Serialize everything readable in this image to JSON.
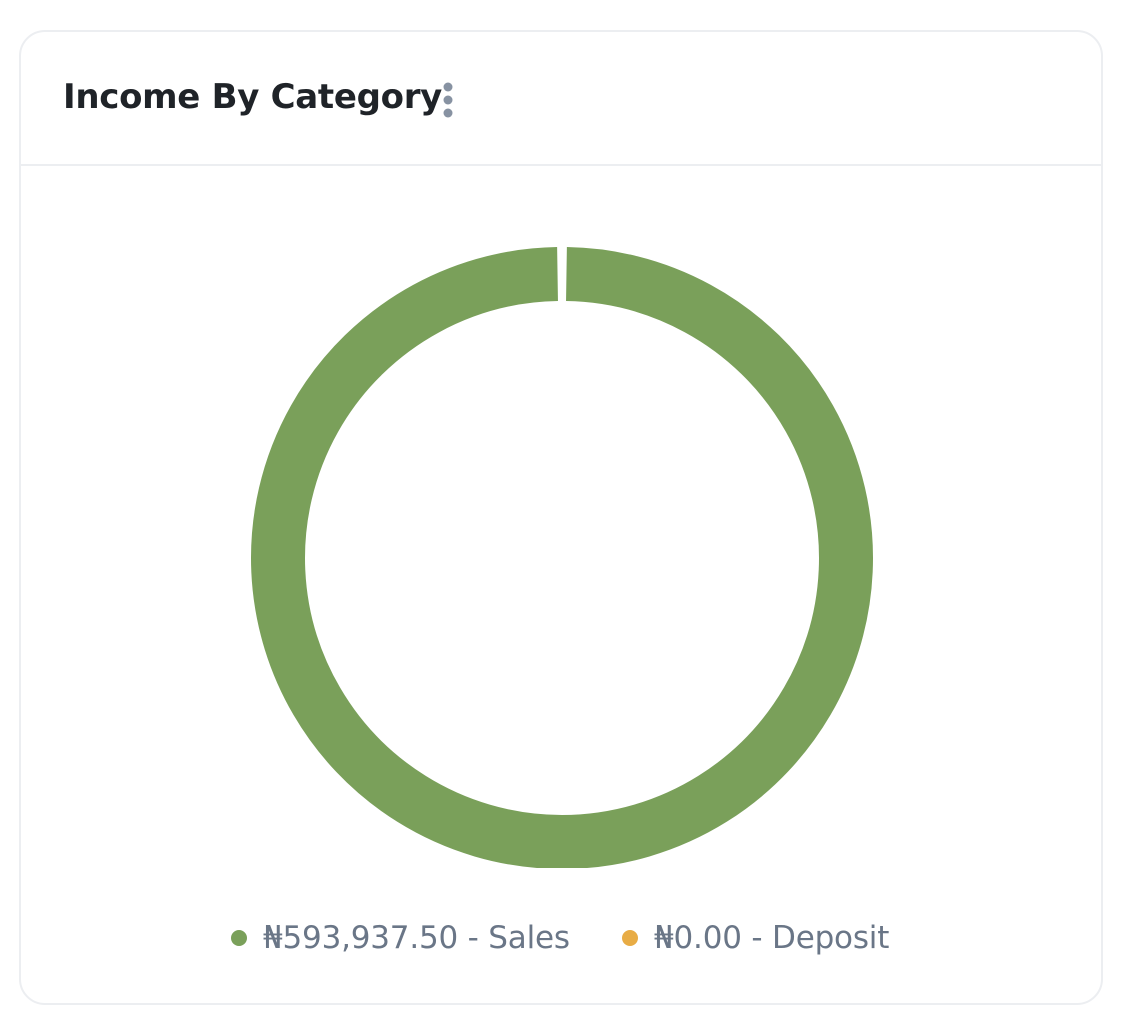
{
  "card": {
    "title": "Income By Category",
    "menu_icon": "kebab-vertical-icon"
  },
  "colors": {
    "sales": "#7aa05a",
    "deposit": "#e8ac45",
    "menu_icon": "#8792a2",
    "legend_text": "#6a7687"
  },
  "chart_data": {
    "type": "pie",
    "donut": true,
    "title": "Income By Category",
    "series": [
      {
        "name": "Sales",
        "label": "₦593,937.50 - Sales",
        "value": 593937.5,
        "color": "#7aa05a"
      },
      {
        "name": "Deposit",
        "label": "₦0.00 - Deposit",
        "value": 0.0,
        "color": "#e8ac45"
      }
    ],
    "legend_position": "bottom"
  }
}
